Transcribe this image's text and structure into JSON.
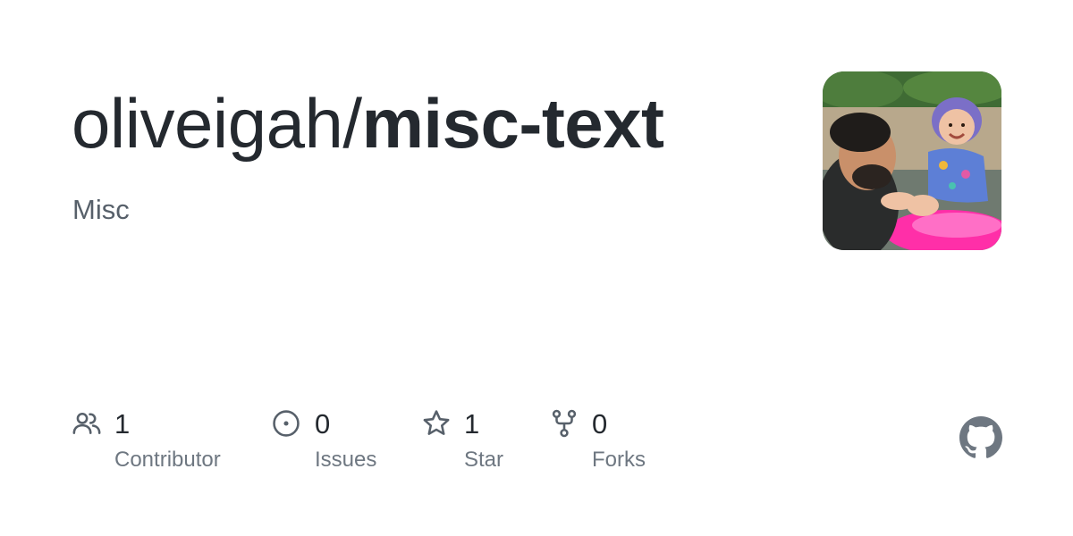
{
  "repo": {
    "owner": "oliveigah/",
    "name": "misc-text",
    "description": "Misc"
  },
  "avatar": {
    "icon": "user-avatar-photo"
  },
  "stats": [
    {
      "icon": "people-icon",
      "value": "1",
      "label": "Contributor"
    },
    {
      "icon": "issue-icon",
      "value": "0",
      "label": "Issues"
    },
    {
      "icon": "star-icon",
      "value": "1",
      "label": "Star"
    },
    {
      "icon": "fork-icon",
      "value": "0",
      "label": "Forks"
    }
  ],
  "brand": {
    "icon": "github-icon",
    "color": "#6e7781"
  },
  "colors": {
    "title": "#24292f",
    "muted": "#57606a",
    "label": "#6e7781"
  }
}
